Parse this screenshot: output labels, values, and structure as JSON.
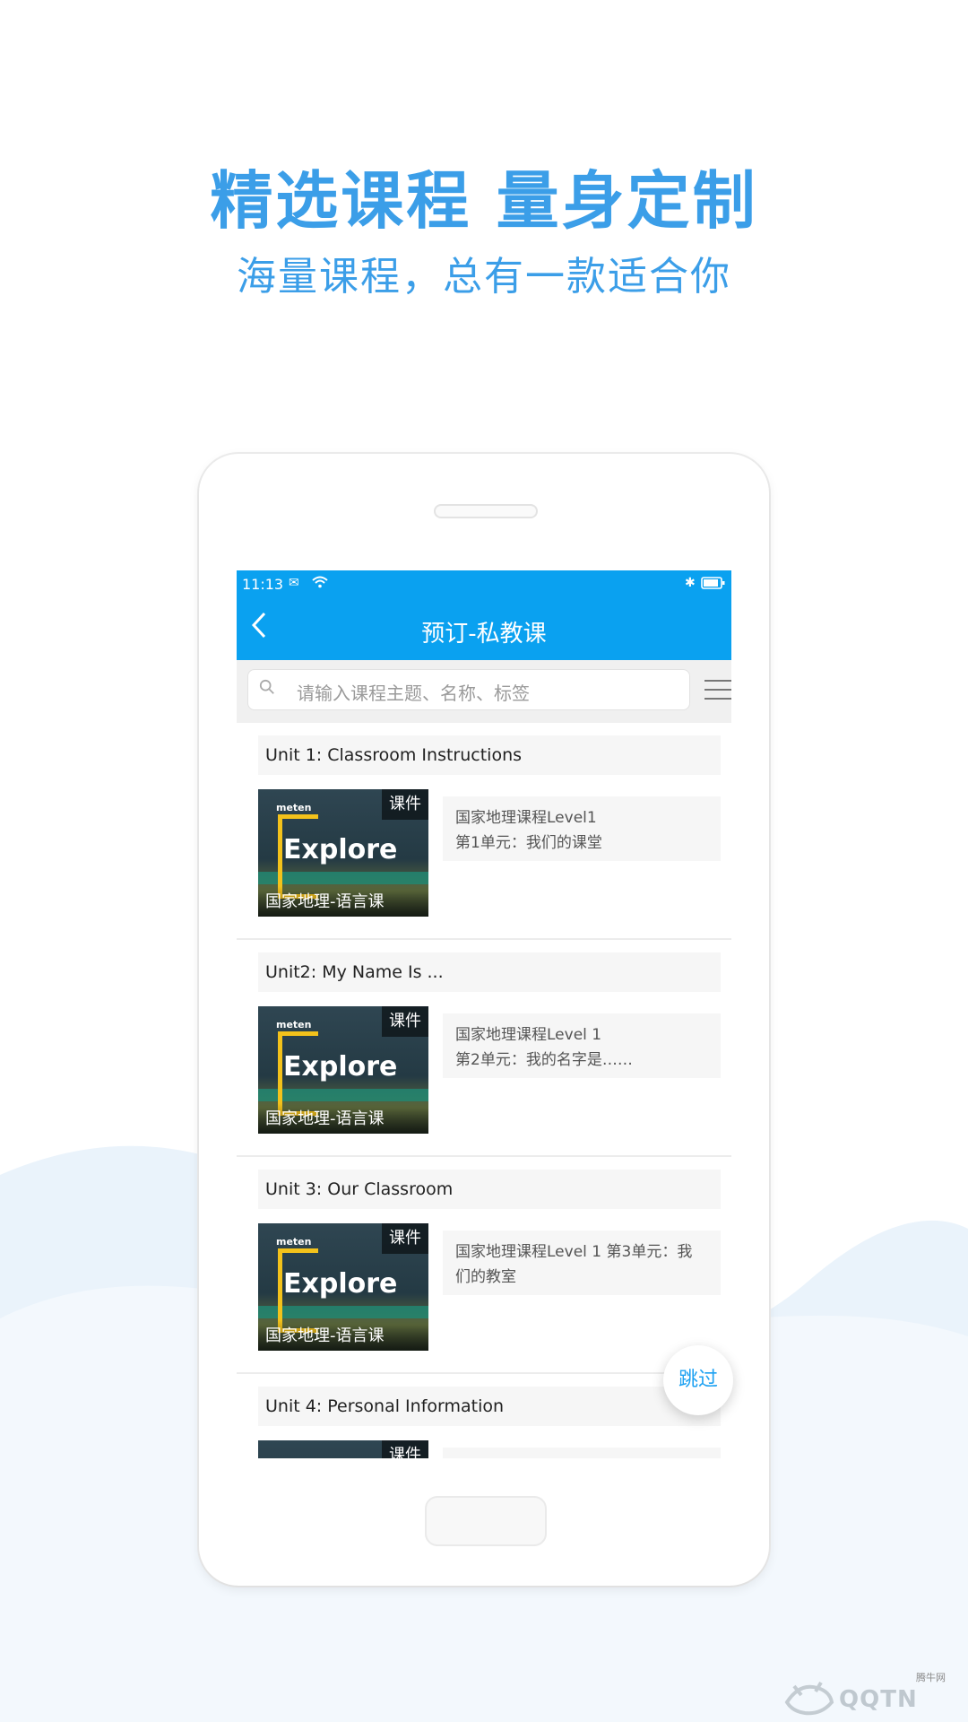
{
  "promo": {
    "headline": "精选课程  量身定制",
    "subline": "海量课程，总有一款适合你"
  },
  "status_bar": {
    "time": "11:13"
  },
  "nav": {
    "title": "预订-私教课"
  },
  "search": {
    "placeholder": "请输入课程主题、名称、标签"
  },
  "courses": [
    {
      "title": "Unit 1: Classroom Instructions",
      "tag": "课件",
      "brand": "meten",
      "cover_word": "Explore",
      "caption": "国家地理-语言课",
      "desc_line1": "国家地理课程Level1",
      "desc_line2": "第1单元：我们的课堂"
    },
    {
      "title": "Unit2: My Name Is ...",
      "tag": "课件",
      "brand": "meten",
      "cover_word": "Explore",
      "caption": "国家地理-语言课",
      "desc_line1": "国家地理课程Level 1",
      "desc_line2": "第2单元：我的名字是……"
    },
    {
      "title": "Unit 3: Our Classroom",
      "tag": "课件",
      "brand": "meten",
      "cover_word": "Explore",
      "caption": "国家地理-语言课",
      "desc_line1": "国家地理课程Level 1 第3单元：我",
      "desc_line2": "们的教室"
    },
    {
      "title": "Unit 4: Personal Information",
      "tag": "课件",
      "brand": "",
      "cover_word": "",
      "caption": "",
      "desc_line1": "",
      "desc_line2": ""
    }
  ],
  "skip": {
    "label": "跳过"
  },
  "watermark": {
    "text": "QQTN",
    "small": "腾牛网"
  },
  "colors": {
    "accent": "#0aa1f0",
    "headline": "#3b9ee8"
  }
}
